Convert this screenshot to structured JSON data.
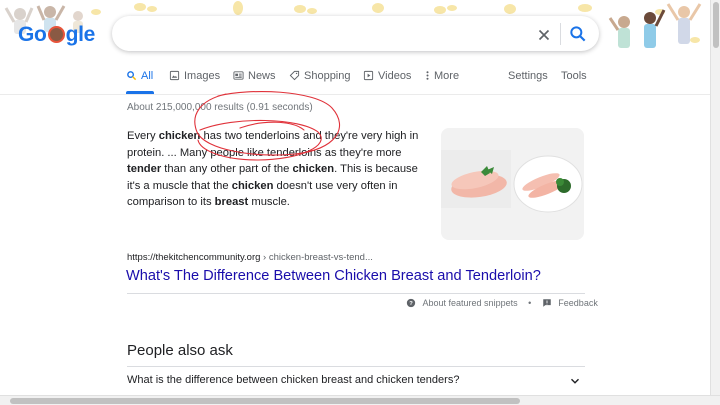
{
  "logo": {
    "text_pre": "Go",
    "text_post": "gle"
  },
  "search": {
    "value": "",
    "placeholder": ""
  },
  "tabs": [
    {
      "label": "All",
      "icon": "search-icon",
      "active": true
    },
    {
      "label": "Images",
      "icon": "image-icon"
    },
    {
      "label": "News",
      "icon": "news-icon"
    },
    {
      "label": "Shopping",
      "icon": "tag-icon"
    },
    {
      "label": "Videos",
      "icon": "video-icon"
    },
    {
      "label": "More",
      "icon": "more-vert-icon"
    }
  ],
  "tools": {
    "settings": "Settings",
    "tools": "Tools"
  },
  "result_stats": "About 215,000,000 results (0.91 seconds)",
  "snippet": {
    "parts": [
      {
        "t": "Every ",
        "b": false
      },
      {
        "t": "chicken",
        "b": true
      },
      {
        "t": " has two tenderloins and they're very high in protein. ... Many people like tenderloins as they're more ",
        "b": false
      },
      {
        "t": "tender",
        "b": true
      },
      {
        "t": " than any other part of the ",
        "b": false
      },
      {
        "t": "chicken",
        "b": true
      },
      {
        "t": ". This is because it's a muscle that the ",
        "b": false
      },
      {
        "t": "chicken",
        "b": true
      },
      {
        "t": " doesn't use very often in comparison to its ",
        "b": false
      },
      {
        "t": "breast",
        "b": true
      },
      {
        "t": " muscle.",
        "b": false
      }
    ]
  },
  "source": {
    "domain": "https://thekitchencommunity.org",
    "path": " › chicken-breast-vs-tend..."
  },
  "result_title": "What's The Difference Between Chicken Breast and Tenderloin?",
  "footer": {
    "about": "About featured snippets",
    "sep": "•",
    "feedback": "Feedback"
  },
  "paa": {
    "title": "People also ask",
    "questions": [
      "What is the difference between chicken breast and chicken tenders?"
    ]
  },
  "colors": {
    "accent": "#1a73e8",
    "link": "#1a0dab",
    "ink": "#e0323a"
  }
}
